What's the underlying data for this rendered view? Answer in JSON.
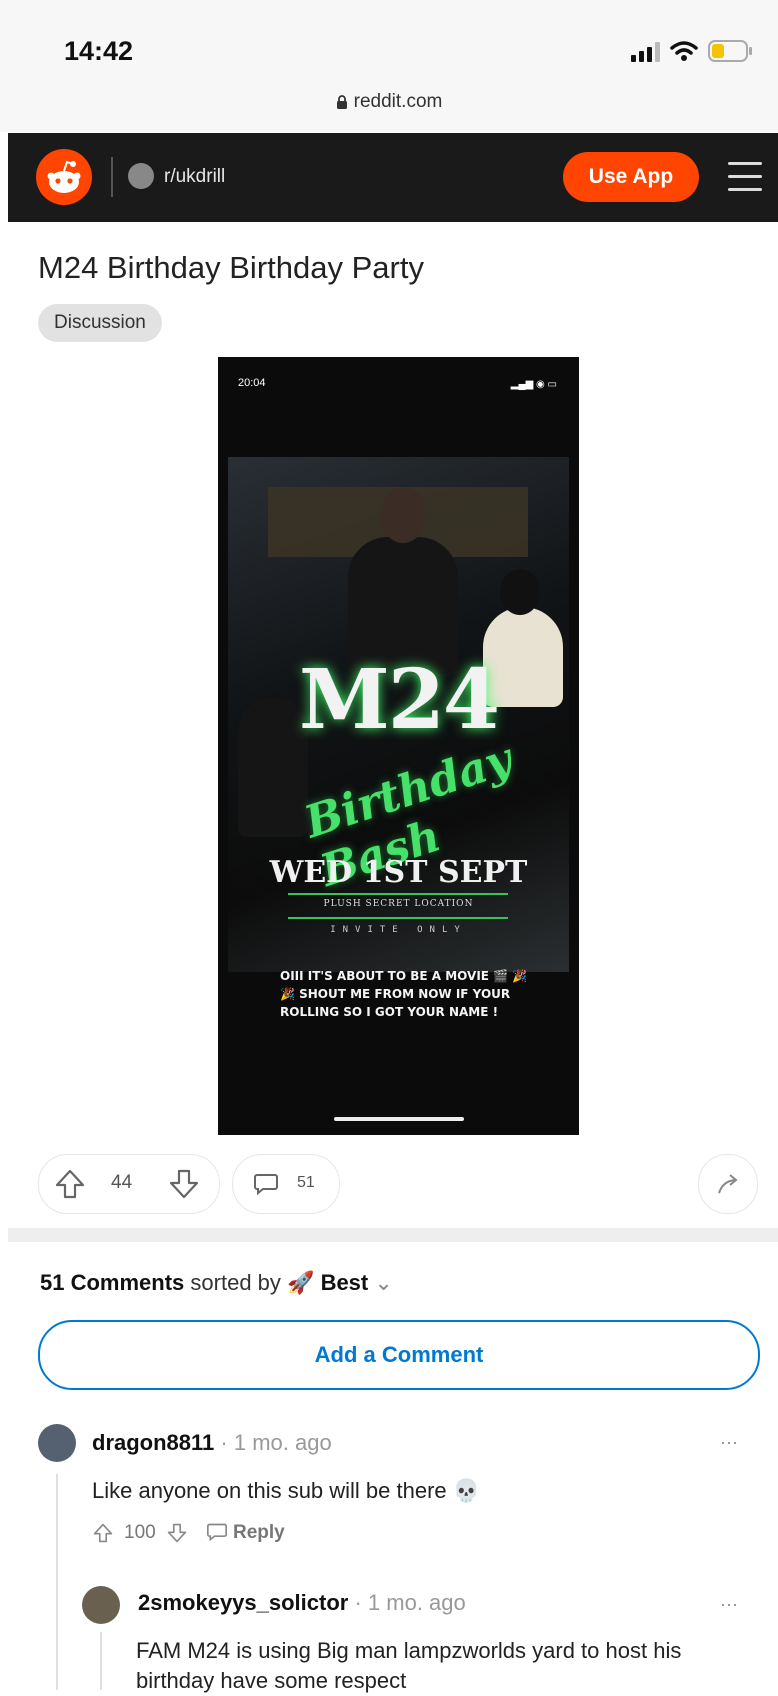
{
  "status_bar": {
    "time": "14:42"
  },
  "browser": {
    "url": "reddit.com"
  },
  "header": {
    "subreddit": "r/ukdrill",
    "use_app_label": "Use App"
  },
  "post": {
    "title": "M24 Birthday Birthday Party",
    "flair": "Discussion",
    "image": {
      "phone_time": "20:04",
      "headline": "M24",
      "subheadline": "Birthday Bash",
      "date": "WED 1ST SEPT",
      "location": "PLUSH SECRET LOCATION",
      "invite": "INVITE ONLY",
      "caption": "OIII IT'S ABOUT TO BE A MOVIE 🎬 🎉 🎉 SHOUT ME FROM NOW IF YOUR ROLLING SO I GOT YOUR NAME !"
    },
    "score": "44",
    "comment_count": "51"
  },
  "comments_section": {
    "count_label": "51 Comments",
    "sorted_by_label": "sorted by",
    "sort_value": "Best",
    "add_comment_label": "Add a Comment"
  },
  "comments": [
    {
      "user": "dragon8811",
      "age": "1 mo. ago",
      "body": "Like anyone on this sub will be there 💀",
      "score": "100",
      "reply_label": "Reply"
    },
    {
      "user": "2smokeyys_solictor",
      "age": "1 mo. ago",
      "body": "FAM M24 is using Big man lampzworlds yard to host his birthday have some respect"
    }
  ],
  "colors": {
    "brand": "#ff4500",
    "link": "#0079d3",
    "header_bg": "#1a1a1b"
  }
}
